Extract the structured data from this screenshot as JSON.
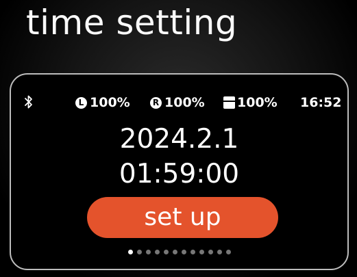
{
  "page": {
    "title": "time setting"
  },
  "status_bar": {
    "bluetooth_icon": "bluetooth-icon",
    "left_badge": "L",
    "left_value": "100%",
    "right_badge": "R",
    "right_value": "100%",
    "case_icon": "charging-case-icon",
    "case_value": "100%",
    "clock": "16:52"
  },
  "main": {
    "date": "2024.2.1",
    "time": "01:59:00",
    "button_label": "set up",
    "button_color": "#e4532c"
  },
  "pagination": {
    "total": 12,
    "active_index": 0
  }
}
